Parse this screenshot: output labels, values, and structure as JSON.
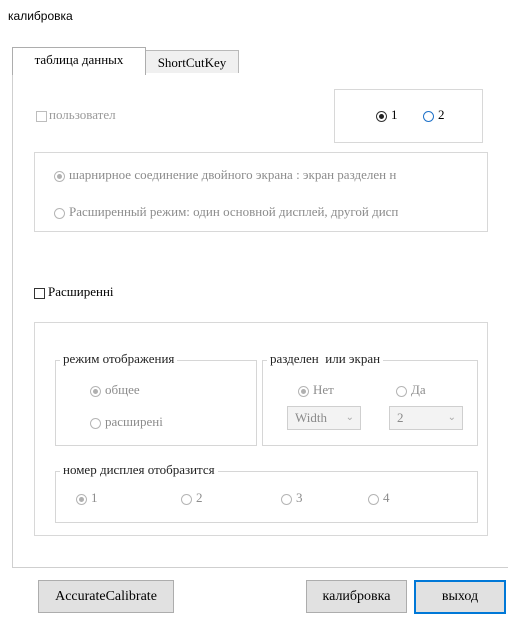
{
  "window": {
    "title": "калибровка"
  },
  "tabs": [
    {
      "label": "таблица данных",
      "active": true
    },
    {
      "label": "ShortCutKey",
      "active": false
    }
  ],
  "user_section": {
    "checkbox_label": "пользовател",
    "radio_1": "1",
    "radio_2": "2",
    "options": [
      "шарнирное соединение двойного экрана : экран разделен н",
      "Расширенный режим: один основной дисплей, другой дисп"
    ]
  },
  "advanced": {
    "checkbox_label": "Расширенні",
    "display_mode": {
      "legend": "режим отображения",
      "option_common": "общее",
      "option_extended": "расширені"
    },
    "split": {
      "legend": "разделен  или экран",
      "option_no": "Нет",
      "option_yes": "Да",
      "select_width": "Width",
      "select_count": "2"
    },
    "display_number": {
      "legend": "номер дисплея отобразится",
      "options": [
        "1",
        "2",
        "3",
        "4"
      ]
    }
  },
  "buttons": {
    "accurate": "AccurateCalibrate",
    "calibrate": "калибровка",
    "exit": "выход"
  },
  "icons": {
    "chevron": "chevron-down-icon"
  }
}
